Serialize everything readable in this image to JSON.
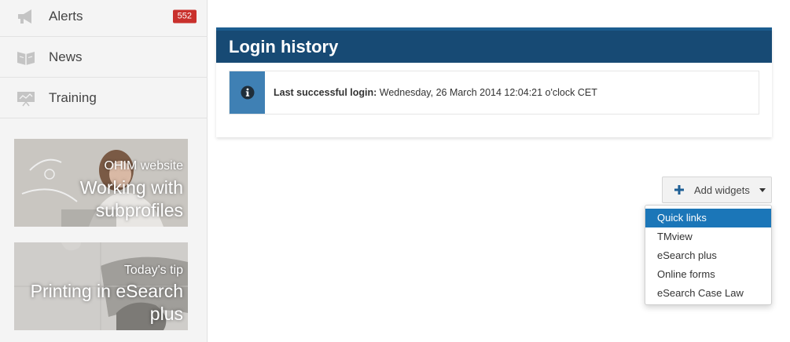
{
  "sidebar": {
    "items": [
      {
        "label": "Alerts",
        "icon": "megaphone-icon",
        "badge": "552"
      },
      {
        "label": "News",
        "icon": "newspaper-icon"
      },
      {
        "label": "Training",
        "icon": "presentation-icon"
      }
    ],
    "promos": [
      {
        "small": "OHIM website",
        "big_line1": "Working with",
        "big_line2": "subprofiles"
      },
      {
        "small": "Today's tip",
        "big_line1": "Printing in eSearch",
        "big_line2": "plus"
      }
    ]
  },
  "login_history": {
    "title": "Login history",
    "label": "Last successful login:",
    "value": "Wednesday, 26 March 2014 12:04:21 o'clock CET"
  },
  "add_widgets": {
    "label": "Add widgets",
    "options": [
      "Quick links",
      "TMview",
      "eSearch plus",
      "Online forms",
      "eSearch Case Law"
    ],
    "highlighted": "Quick links"
  },
  "colors": {
    "header_blue": "#174a74",
    "info_blue": "#3f80b4",
    "badge_red": "#c9302c",
    "highlight_blue": "#1b76b8"
  }
}
